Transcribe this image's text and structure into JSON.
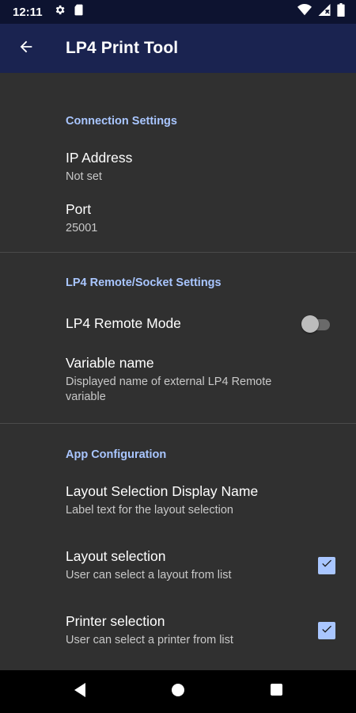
{
  "status_bar": {
    "time": "12:11",
    "left_icons": [
      "gear-icon",
      "sd-card-icon"
    ],
    "right_icons": [
      "wifi-icon",
      "signal-icon",
      "battery-icon"
    ]
  },
  "app_bar": {
    "title": "LP4 Print Tool",
    "back_icon": "arrow-back-icon",
    "background": "#1a2350"
  },
  "sections": {
    "connection": {
      "title": "Connection Settings",
      "ip_address": {
        "title": "IP Address",
        "summary": "Not set"
      },
      "port": {
        "title": "Port",
        "summary": "25001"
      }
    },
    "remote": {
      "title": "LP4 Remote/Socket Settings",
      "remote_mode": {
        "title": "LP4 Remote Mode",
        "enabled": false
      },
      "variable_name": {
        "title": "Variable name",
        "summary": "Displayed name of external LP4 Remote variable"
      }
    },
    "app_config": {
      "title": "App Configuration",
      "layout_display_name": {
        "title": "Layout Selection Display Name",
        "summary": "Label text for the layout selection"
      },
      "layout_selection": {
        "title": "Layout selection",
        "summary": "User can select a layout from list",
        "checked": true
      },
      "printer_selection": {
        "title": "Printer selection",
        "summary": "User can select a printer from list",
        "checked": true
      }
    }
  },
  "colors": {
    "accent": "#a9c6ff",
    "background": "#303030",
    "status_bar": "#0d1330"
  },
  "nav_bar": {
    "buttons": [
      "back-triangle-icon",
      "home-circle-icon",
      "recents-square-icon"
    ]
  }
}
